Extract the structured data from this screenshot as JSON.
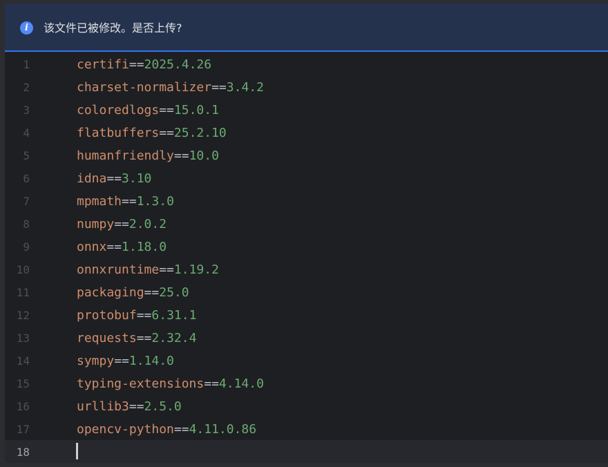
{
  "banner": {
    "icon": "info-icon",
    "icon_glyph": "i",
    "message": "该文件已被修改。是否上传?"
  },
  "editor": {
    "lines": [
      {
        "num": "1",
        "pkg": "certifi",
        "op": "==",
        "ver": "2025.4.26"
      },
      {
        "num": "2",
        "pkg": "charset-normalizer",
        "op": "==",
        "ver": "3.4.2"
      },
      {
        "num": "3",
        "pkg": "coloredlogs",
        "op": "==",
        "ver": "15.0.1"
      },
      {
        "num": "4",
        "pkg": "flatbuffers",
        "op": "==",
        "ver": "25.2.10"
      },
      {
        "num": "5",
        "pkg": "humanfriendly",
        "op": "==",
        "ver": "10.0"
      },
      {
        "num": "6",
        "pkg": "idna",
        "op": "==",
        "ver": "3.10"
      },
      {
        "num": "7",
        "pkg": "mpmath",
        "op": "==",
        "ver": "1.3.0"
      },
      {
        "num": "8",
        "pkg": "numpy",
        "op": "==",
        "ver": "2.0.2"
      },
      {
        "num": "9",
        "pkg": "onnx",
        "op": "==",
        "ver": "1.18.0"
      },
      {
        "num": "10",
        "pkg": "onnxruntime",
        "op": "==",
        "ver": "1.19.2"
      },
      {
        "num": "11",
        "pkg": "packaging",
        "op": "==",
        "ver": "25.0"
      },
      {
        "num": "12",
        "pkg": "protobuf",
        "op": "==",
        "ver": "6.31.1"
      },
      {
        "num": "13",
        "pkg": "requests",
        "op": "==",
        "ver": "2.32.4"
      },
      {
        "num": "14",
        "pkg": "sympy",
        "op": "==",
        "ver": "1.14.0"
      },
      {
        "num": "15",
        "pkg": "typing-extensions",
        "op": "==",
        "ver": "4.14.0"
      },
      {
        "num": "16",
        "pkg": "urllib3",
        "op": "==",
        "ver": "2.5.0"
      },
      {
        "num": "17",
        "pkg": "opencv-python",
        "op": "==",
        "ver": "4.11.0.86"
      },
      {
        "num": "18",
        "pkg": "",
        "op": "",
        "ver": ""
      }
    ],
    "current_line": 18
  },
  "colors": {
    "banner_bg": "#25324d",
    "banner_border": "#3574f0",
    "info_icon": "#548af7",
    "package_name": "#cf8e6d",
    "operator": "#bcbec4",
    "version": "#6aab73",
    "line_number": "#4b5059",
    "editor_bg": "#1e1f22"
  }
}
